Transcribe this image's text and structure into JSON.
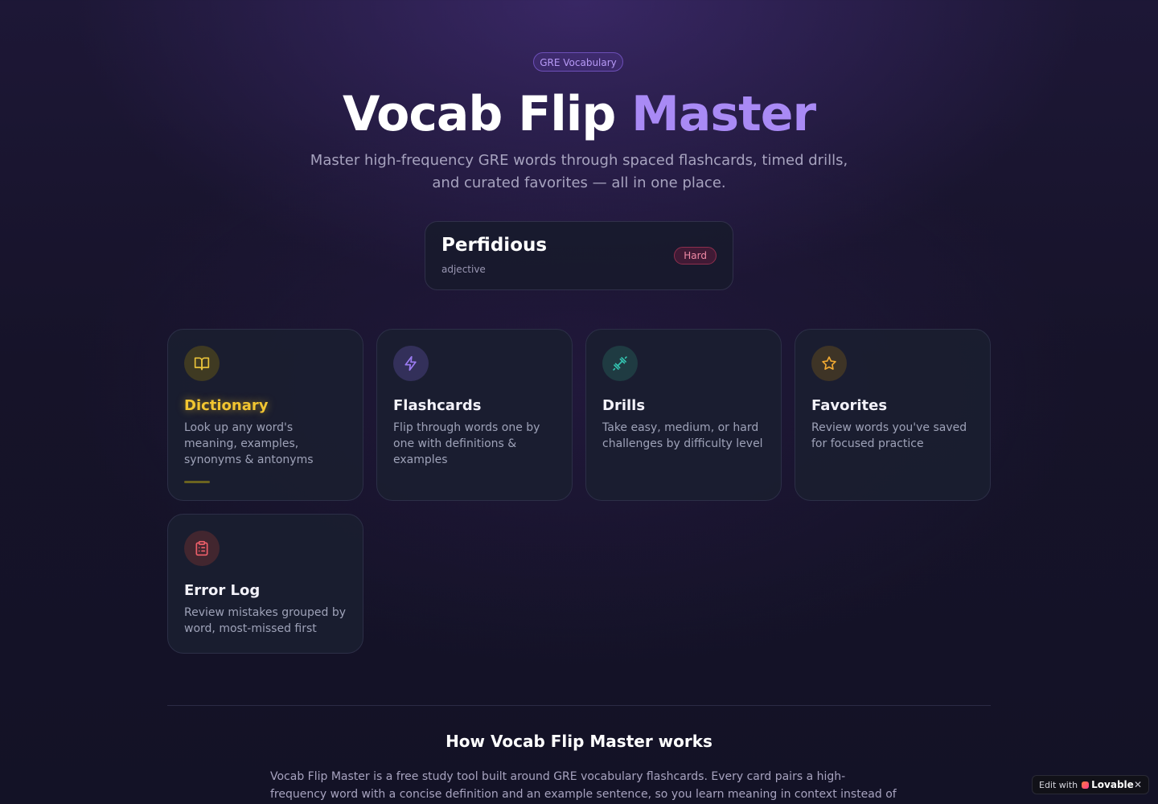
{
  "hero": {
    "badge": "GRE Vocabulary",
    "title_main": "Vocab Flip",
    "title_accent": "Master",
    "subtitle": "Master high-frequency GRE words through spaced flashcards, timed drills, and curated favorites — all in one place."
  },
  "word_of_day": {
    "word": "Perfidious",
    "part_of_speech": "adjective",
    "difficulty": "Hard",
    "difficulty_color": "#f08aa6"
  },
  "features": [
    {
      "title": "Dictionary",
      "description": "Look up any word's meaning, examples, synonyms & antonyms",
      "icon": "book-open-icon",
      "accent": "#e8c23a",
      "active": true
    },
    {
      "title": "Flashcards",
      "description": "Flip through words one by one with definitions & examples",
      "icon": "lightning-icon",
      "accent": "#9b7bf2"
    },
    {
      "title": "Drills",
      "description": "Take easy, medium, or hard challenges by difficulty level",
      "icon": "dumbbell-icon",
      "accent": "#34c5b1"
    },
    {
      "title": "Favorites",
      "description": "Review words you've saved for focused practice",
      "icon": "star-icon",
      "accent": "#f0a932"
    },
    {
      "title": "Error Log",
      "description": "Review mistakes grouped by word, most-missed first",
      "icon": "clipboard-list-icon",
      "accent": "#ef5f6a"
    }
  ],
  "how_it_works": {
    "title": "How Vocab Flip Master works",
    "body": "Vocab Flip Master is a free study tool built around GRE vocabulary flashcards. Every card pairs a high-frequency word with a concise definition and an example sentence, so you learn meaning in context instead of memorizing isolated"
  },
  "lovable_badge": {
    "edit_label": "Edit with",
    "brand": "Lovable",
    "close_label": "✕"
  }
}
